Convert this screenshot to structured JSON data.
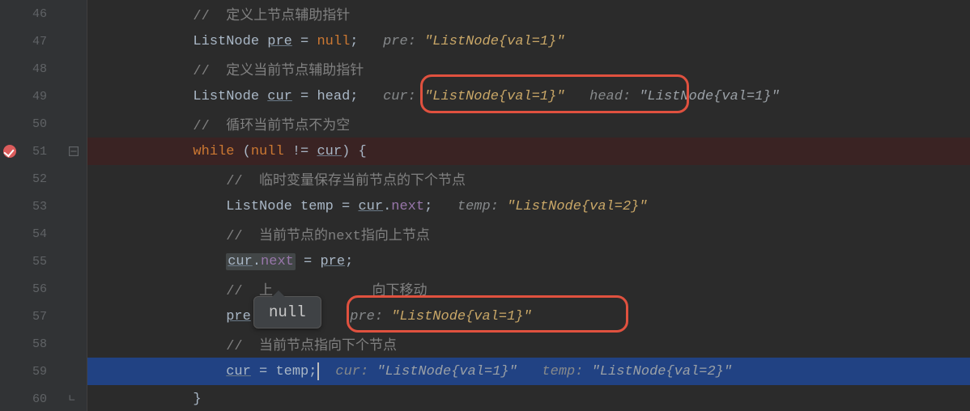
{
  "gutter": {
    "l46": "46",
    "l47": "47",
    "l48": "48",
    "l49": "49",
    "l50": "50",
    "l51": "51",
    "l52": "52",
    "l53": "53",
    "l54": "54",
    "l55": "55",
    "l56": "56",
    "l57": "57",
    "l58": "58",
    "l59": "59",
    "l60": "60"
  },
  "code": {
    "indent3": "            ",
    "indent4": "                ",
    "c46": "//  定义上节点辅助指针",
    "l47_type": "ListNode ",
    "l47_var": "pre",
    "l47_assign": " = ",
    "l47_null": "null",
    "l47_semi": ";   ",
    "c48": "//  定义当前节点辅助指针",
    "l49_type": "ListNode ",
    "l49_var": "cur",
    "l49_assign": " = head;   ",
    "c50": "//  循环当前节点不为空",
    "l51_while": "while ",
    "l51_open": "(",
    "l51_null": "null",
    "l51_neq": " != ",
    "l51_cur": "cur",
    "l51_close": ") {",
    "c52": "//  临时变量保存当前节点的下个节点",
    "l53_type": "ListNode temp = ",
    "l53_cur": "cur",
    "l53_dot": ".",
    "l53_next": "next",
    "l53_semi": ";   ",
    "c54": "//  当前节点的next指向上节点",
    "l55_cur": "cur",
    "l55_dot": ".",
    "l55_next": "next",
    "l55_assign": " = ",
    "l55_pre": "pre",
    "l55_semi": ";",
    "c56": "//  上            向下移动",
    "l57_pre": "pre",
    "l57_sp": "            ",
    "c58": "//  当前节点指向下个节点",
    "l59_cur": "cur",
    "l59_assign": " = temp;",
    "l60_brace": "}"
  },
  "inlay": {
    "l47_label": "pre: ",
    "l47_val": "\"ListNode{val=1}\"",
    "l49_cur_label": "cur: ",
    "l49_cur_val": "\"ListNode{val=1}\"",
    "l49_head_label": "   head: ",
    "l49_head_val": "\"ListNode{val=1}\"",
    "l53_label": "temp: ",
    "l53_val": "\"ListNode{val=2}\"",
    "l57_label": "pre: ",
    "l57_val": "\"ListNode{val=1}\"",
    "l59_cur_label": "  cur: ",
    "l59_cur_val": "\"ListNode{val=1}\"",
    "l59_temp_label": "   temp: ",
    "l59_temp_val": "\"ListNode{val=2}\""
  },
  "tooltip": {
    "text": "null"
  }
}
